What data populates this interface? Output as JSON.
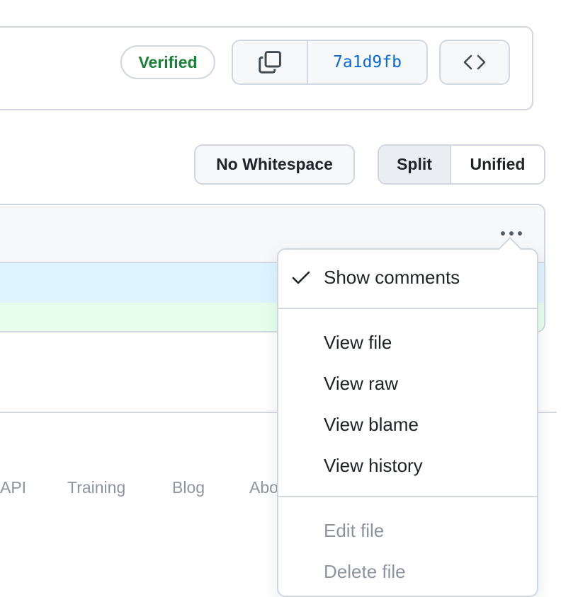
{
  "commit": {
    "verified_label": "Verified",
    "sha": "7a1d9fb",
    "copy_icon": "copy-icon",
    "code_icon": "code-icon"
  },
  "toolbar": {
    "whitespace_label": "No Whitespace",
    "split_label": "Split",
    "unified_label": "Unified",
    "selected_view": "Split"
  },
  "file": {
    "menu_icon": "kebab-horizontal-icon",
    "hunk_color": "#ddf4ff",
    "added_color": "#e6ffec"
  },
  "menu": {
    "show_comments": "Show comments",
    "show_comments_checked": true,
    "view_file": "View file",
    "view_raw": "View raw",
    "view_blame": "View blame",
    "view_history": "View history",
    "edit_file": "Edit file",
    "delete_file": "Delete file"
  },
  "footer": {
    "links": [
      "API",
      "Training",
      "Blog",
      "Abo"
    ]
  },
  "colors": {
    "verified_green": "#1a7f37",
    "link_blue": "#0969da",
    "border": "#d0d7de",
    "muted": "#8c959f"
  }
}
